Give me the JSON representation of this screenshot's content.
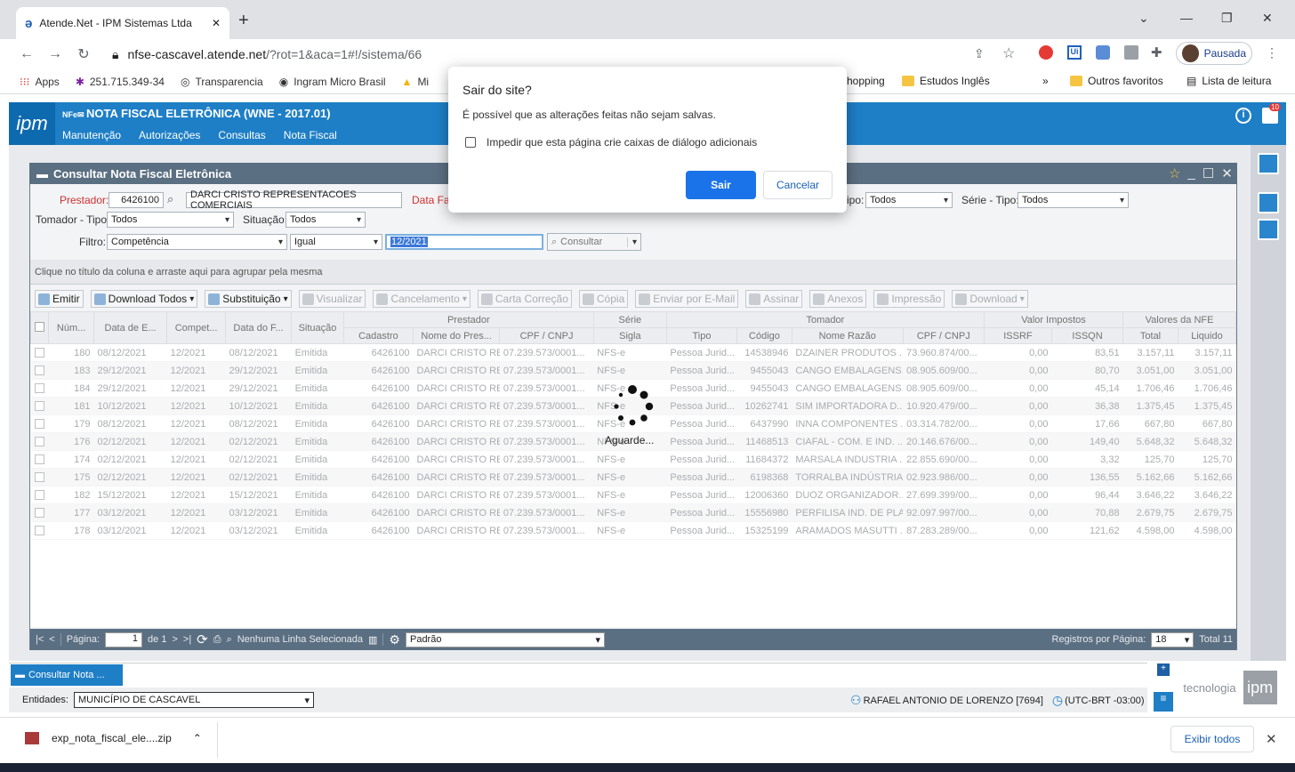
{
  "browser": {
    "tab_title": "Atende.Net - IPM Sistemas Ltda",
    "url_host": "nfse-cascavel.atende.net",
    "url_path": "/?rot=1&aca=1#!/sistema/66",
    "profile_label": "Pausada",
    "bookmarks": [
      "Apps",
      "251.715.349-34",
      "Transparencia",
      "Ingram Micro Brasil",
      "Mi",
      "hopping",
      "Estudos Inglês"
    ],
    "bookmarks_more": "»",
    "other_favorites": "Outros favoritos",
    "reading_list": "Lista de leitura"
  },
  "app": {
    "logo": "ipm",
    "title": "NOTA FISCAL ELETRÔNICA (WNE - 2017.01)",
    "menu": [
      "Manutenção",
      "Autorizações",
      "Consultas",
      "Nota Fiscal"
    ],
    "notif_count": "10"
  },
  "window": {
    "title": "Consultar Nota Fiscal Eletrônica",
    "filters": {
      "prestador_label": "Prestador:",
      "prestador_code": "6426100",
      "prestador_name": "DARCI CRISTO REPRESENTACOES COMERCIAIS",
      "data_label": "Data Fat",
      "tipo_label": "ipo:",
      "tipo_value": "Todos",
      "serie_label": "Série - Tipo:",
      "serie_value": "Todos",
      "tomador_label": "Tomador - Tipo:",
      "tomador_value": "Todos",
      "situacao_label": "Situação:",
      "situacao_value": "Todos",
      "filtro_label": "Filtro:",
      "filtro_value": "Competência",
      "operator_value": "Igual",
      "filtro_text": "12/2021",
      "consultar_label": "Consultar"
    },
    "group_hint": "Clique no título da coluna e arraste aqui para agrupar pela mesma",
    "toolbar": [
      {
        "label": "Emitir",
        "dropdown": false,
        "enabled": true
      },
      {
        "label": "Download Todos",
        "dropdown": true,
        "enabled": true
      },
      {
        "label": "Substituição",
        "dropdown": true,
        "enabled": true
      },
      {
        "label": "Visualizar",
        "dropdown": false,
        "enabled": false
      },
      {
        "label": "Cancelamento",
        "dropdown": true,
        "enabled": false
      },
      {
        "label": "Carta Correção",
        "dropdown": false,
        "enabled": false
      },
      {
        "label": "Cópia",
        "dropdown": false,
        "enabled": false
      },
      {
        "label": "Enviar por E-Mail",
        "dropdown": false,
        "enabled": false
      },
      {
        "label": "Assinar",
        "dropdown": false,
        "enabled": false
      },
      {
        "label": "Anexos",
        "dropdown": false,
        "enabled": false
      },
      {
        "label": "Impressão",
        "dropdown": false,
        "enabled": false
      },
      {
        "label": "Download",
        "dropdown": true,
        "enabled": false
      }
    ],
    "groups": [
      {
        "label": ""
      },
      {
        "label": "Núm..."
      },
      {
        "label": "Data de E..."
      },
      {
        "label": "Compet..."
      },
      {
        "label": "Data do F..."
      },
      {
        "label": "Situação"
      },
      {
        "label": "Prestador"
      },
      {
        "label": "Série"
      },
      {
        "label": "Tomador"
      },
      {
        "label": "Valor Impostos"
      },
      {
        "label": "Valores da NFE"
      }
    ],
    "subcolumns": [
      "Cadastro",
      "Nome do Pres...",
      "CPF / CNPJ",
      "Sigla",
      "Tipo",
      "Código",
      "Nome Razão",
      "CPF / CNPJ",
      "ISSRF",
      "ISSQN",
      "Total",
      "Liquido"
    ],
    "rows": [
      [
        "180",
        "08/12/2021",
        "12/2021",
        "08/12/2021",
        "Emitida",
        "6426100",
        "DARCI CRISTO RE...",
        "07.239.573/0001...",
        "NFS-e",
        "Pessoa Jurid...",
        "14538946",
        "DZAINER PRODUTOS ...",
        "73.960.874/00...",
        "0,00",
        "83,51",
        "3.157,11",
        "3.157,11"
      ],
      [
        "183",
        "29/12/2021",
        "12/2021",
        "29/12/2021",
        "Emitida",
        "6426100",
        "DARCI CRISTO RE...",
        "07.239.573/0001...",
        "NFS-e",
        "Pessoa Jurid...",
        "9455043",
        "CANGO EMBALAGENS...",
        "08.905.609/00...",
        "0,00",
        "80,70",
        "3.051,00",
        "3.051,00"
      ],
      [
        "184",
        "29/12/2021",
        "12/2021",
        "29/12/2021",
        "Emitida",
        "6426100",
        "DARCI CRISTO RE...",
        "07.239.573/0001...",
        "NFS-e",
        "Pessoa Jurid...",
        "9455043",
        "CANGO EMBALAGENS...",
        "08.905.609/00...",
        "0,00",
        "45,14",
        "1.706,46",
        "1.706,46"
      ],
      [
        "181",
        "10/12/2021",
        "12/2021",
        "10/12/2021",
        "Emitida",
        "6426100",
        "DARCI CRISTO RE...",
        "07.239.573/0001...",
        "NFS-e",
        "Pessoa Jurid...",
        "10262741",
        "SIM IMPORTADORA D...",
        "10.920.479/00...",
        "0,00",
        "36,38",
        "1.375,45",
        "1.375,45"
      ],
      [
        "179",
        "08/12/2021",
        "12/2021",
        "08/12/2021",
        "Emitida",
        "6426100",
        "DARCI CRISTO RE...",
        "07.239.573/0001...",
        "NFS-e",
        "Pessoa Jurid...",
        "6437990",
        "INNA COMPONENTES ...",
        "03.314.782/00...",
        "0,00",
        "17,66",
        "667,80",
        "667,80"
      ],
      [
        "176",
        "02/12/2021",
        "12/2021",
        "02/12/2021",
        "Emitida",
        "6426100",
        "DARCI CRISTO RE...",
        "07.239.573/0001...",
        "NFS-e",
        "Pessoa Jurid...",
        "11468513",
        "CIAFAL - COM. E IND. ...",
        "20.146.676/00...",
        "0,00",
        "149,40",
        "5.648,32",
        "5.648,32"
      ],
      [
        "174",
        "02/12/2021",
        "12/2021",
        "02/12/2021",
        "Emitida",
        "6426100",
        "DARCI CRISTO RE...",
        "07.239.573/0001...",
        "NFS-e",
        "Pessoa Jurid...",
        "11684372",
        "MARSALA INDUSTRIA ...",
        "22.855.690/00...",
        "0,00",
        "3,32",
        "125,70",
        "125,70"
      ],
      [
        "175",
        "02/12/2021",
        "12/2021",
        "02/12/2021",
        "Emitida",
        "6426100",
        "DARCI CRISTO RE...",
        "07.239.573/0001...",
        "NFS-e",
        "Pessoa Jurid...",
        "6198368",
        "TORRALBA INDÚSTRIA ...",
        "02.923.986/00...",
        "0,00",
        "136,55",
        "5.162,66",
        "5.162,66"
      ],
      [
        "182",
        "15/12/2021",
        "12/2021",
        "15/12/2021",
        "Emitida",
        "6426100",
        "DARCI CRISTO RE...",
        "07.239.573/0001...",
        "NFS-e",
        "Pessoa Jurid...",
        "12006360",
        "DUOZ ORGANIZADOR...",
        "27.699.399/00...",
        "0,00",
        "96,44",
        "3.646,22",
        "3.646,22"
      ],
      [
        "177",
        "03/12/2021",
        "12/2021",
        "03/12/2021",
        "Emitida",
        "6426100",
        "DARCI CRISTO RE...",
        "07.239.573/0001...",
        "NFS-e",
        "Pessoa Jurid...",
        "15556980",
        "PERFILISA IND. DE PLA...",
        "92.097.997/00...",
        "0,00",
        "70,88",
        "2.679,75",
        "2.679,75"
      ],
      [
        "178",
        "03/12/2021",
        "12/2021",
        "03/12/2021",
        "Emitida",
        "6426100",
        "DARCI CRISTO RE...",
        "07.239.573/0001...",
        "NFS-e",
        "Pessoa Jurid...",
        "15325199",
        "ARAMADOS MASUTTI ...",
        "87.283.289/00...",
        "0,00",
        "121,62",
        "4.598,00",
        "4.598,00"
      ]
    ],
    "loading_text": "Aguarde...",
    "pager": {
      "page_label": "Página:",
      "page_value": "1",
      "of_label": "de 1",
      "selection_status": "Nenhuma Linha Selecionada",
      "layout_value": "Padrão",
      "per_page_label": "Registros por Página:",
      "per_page_value": "18",
      "total_label": "Total 11"
    }
  },
  "taskbar": {
    "tab_label": "Consultar Nota ...",
    "entities_label": "Entidades:",
    "entities_value": "MUNICÍPIO DE CASCAVEL",
    "user": "RAFAEL ANTONIO DE LORENZO [7694]",
    "timezone": "(UTC-BRT -03:00)",
    "brand_text": "tecnologia",
    "brand_logo": "ipm"
  },
  "download": {
    "filename": "exp_nota_fiscal_ele....zip",
    "show_all": "Exibir todos"
  },
  "dialog": {
    "title": "Sair do site?",
    "message": "É possível que as alterações feitas não sejam salvas.",
    "checkbox_label": "Impedir que esta página crie caixas de diálogo adicionais",
    "confirm_label": "Sair",
    "cancel_label": "Cancelar"
  },
  "colors": {
    "accent": "#1e7fc6",
    "window_title": "#5b6f82",
    "dialog_primary": "#1a73e8",
    "required_label": "#d03030"
  }
}
